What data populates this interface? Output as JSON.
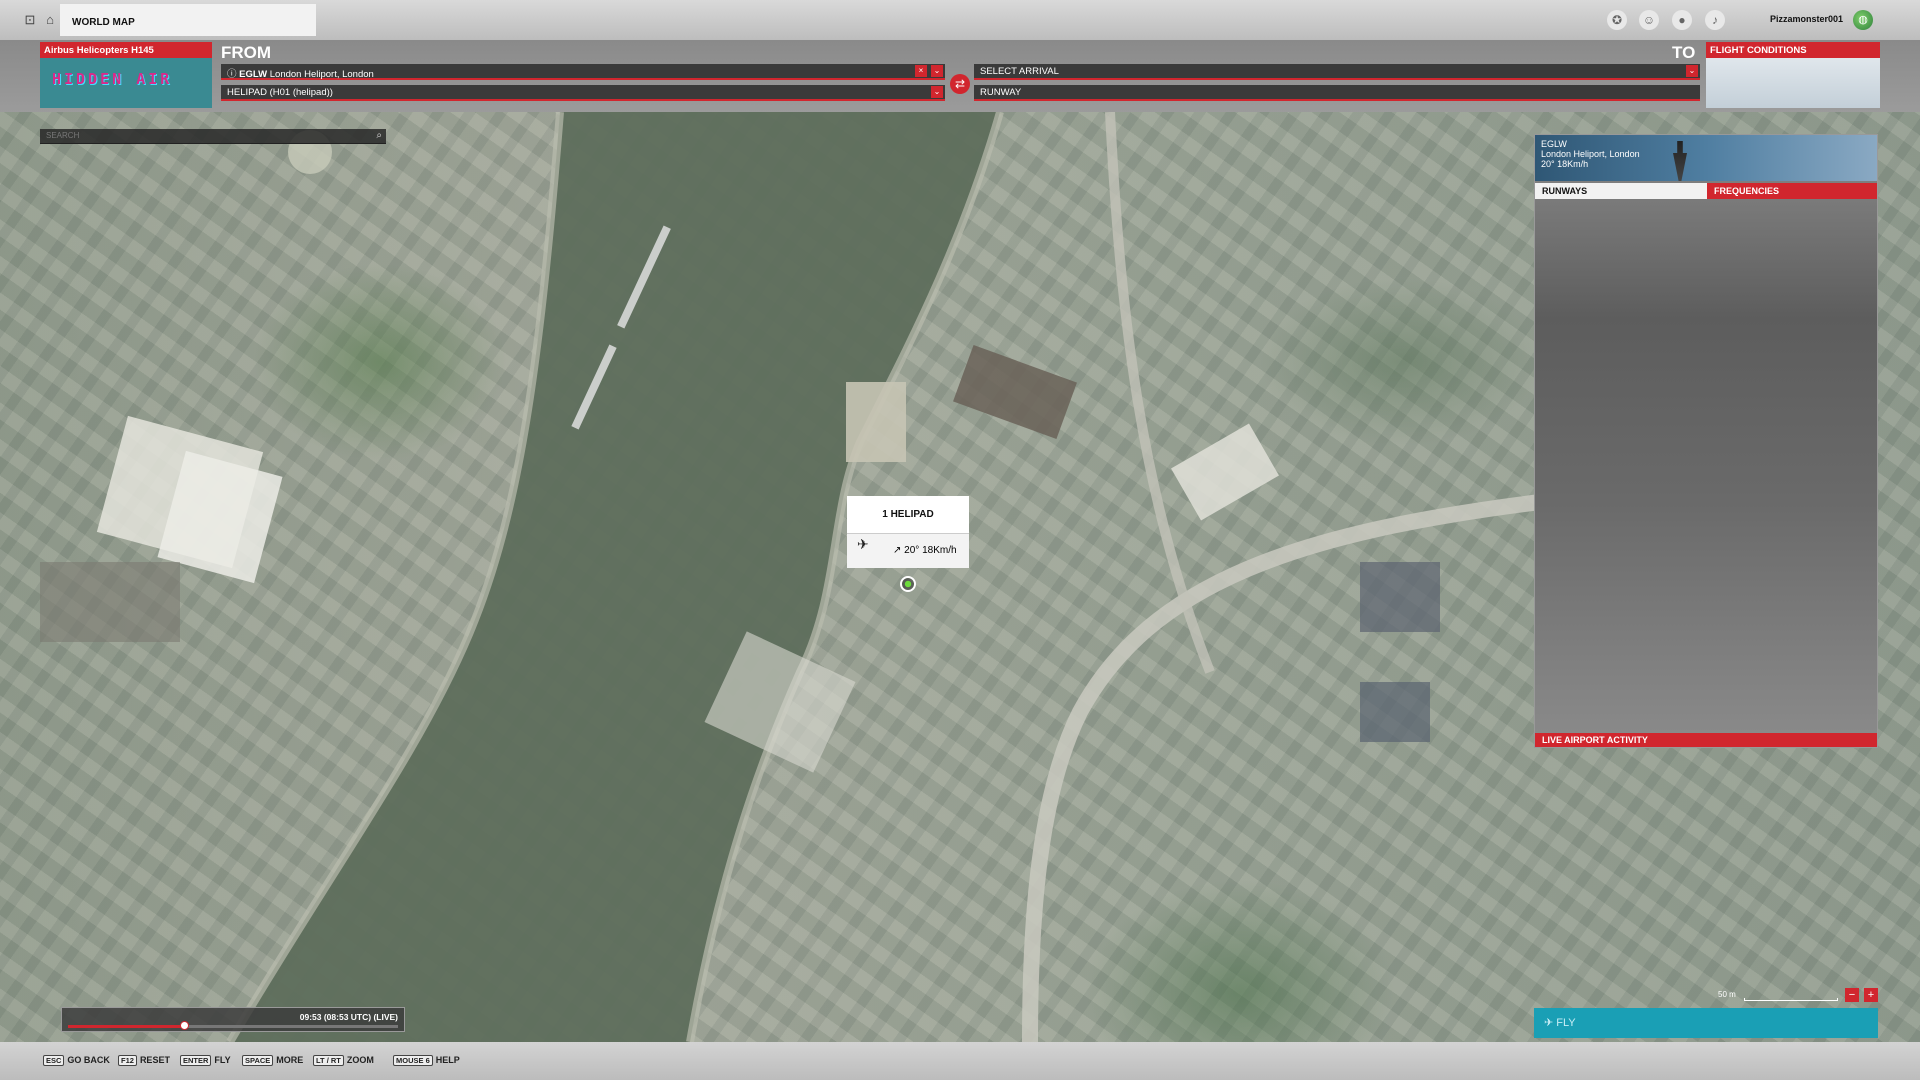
{
  "topbar": {
    "tab_title": "WORLD MAP",
    "username": "Pizzamonster001",
    "left_icons": [
      "lb-icon",
      "home-icon"
    ],
    "right_icons": [
      "achievements-icon",
      "friends-icon",
      "profile-icon",
      "notifications-icon"
    ]
  },
  "header": {
    "aircraft_label": "Airbus Helicopters H145",
    "livery_logo": "HIDDEN AIR",
    "from_label": "FROM",
    "to_label": "TO",
    "departure_code": "EGLW",
    "departure_name": "London Heliport, London",
    "departure_spot": "HELIPAD (H01 (helipad))",
    "arrival_placeholder": "SELECT ARRIVAL",
    "runway_placeholder": "RUNWAY",
    "flight_conditions_label": "FLIGHT CONDITIONS"
  },
  "search": {
    "placeholder": "SEARCH"
  },
  "popup": {
    "title": "1 HELIPAD",
    "wind": "20° 18Km/h"
  },
  "airport_panel": {
    "code": "EGLW",
    "name": "London Heliport, London",
    "wind": "20° 18Km/h",
    "tabs": [
      "RUNWAYS",
      "FREQUENCIES"
    ],
    "active_tab": "RUNWAYS",
    "live_activity_label": "LIVE AIRPORT ACTIVITY"
  },
  "map_controls": {
    "scale_label": "50 m",
    "zoom_out": "−",
    "zoom_in": "+"
  },
  "fly_button": {
    "label": "FLY"
  },
  "time": {
    "label": "09:53 (08:53 UTC) (LIVE)",
    "progress": 0.35
  },
  "bottom_hints": [
    {
      "key": "ESC",
      "action": "GO BACK"
    },
    {
      "key": "F12",
      "action": "RESET"
    },
    {
      "key": "ENTER",
      "action": "FLY"
    },
    {
      "key": "SPACE",
      "action": "MORE"
    },
    {
      "key": "LT / RT",
      "action": "ZOOM"
    },
    {
      "key": "MOUSE 6",
      "action": "HELP"
    }
  ],
  "colors": {
    "accent": "#d1262e",
    "fly": "#1a9fb5",
    "river": "#5e6e5c"
  }
}
